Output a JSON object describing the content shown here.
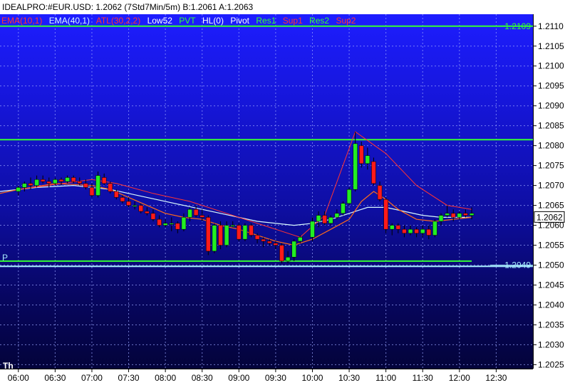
{
  "window": {
    "title": "IDEALPRO:#EUR.USD: 1.2062 (7Std7Min/5m)  B:1.2061 A:1.2063"
  },
  "legend": [
    {
      "label": "EMA(10,1)",
      "color": "#ff3333"
    },
    {
      "label": "EMA(40,1)",
      "color": "#d8f8ff"
    },
    {
      "label": "ATL(30,2,2)",
      "color": "#ff3333"
    },
    {
      "label": "Low52",
      "color": "#ffffff"
    },
    {
      "label": "PVT",
      "color": "#33ff33"
    },
    {
      "label": "HL(0)",
      "color": "#ffffff"
    },
    {
      "label": "Pivot",
      "color": "#ffffff"
    },
    {
      "label": "Res1",
      "color": "#33ff33"
    },
    {
      "label": "Sup1",
      "color": "#ff3333"
    },
    {
      "label": "Res2",
      "color": "#33ff33"
    },
    {
      "label": "Sup2",
      "color": "#ff3333"
    }
  ],
  "colors": {
    "up_candle": "#22ee22",
    "down_candle": "#ff1a1a",
    "wick": "#000000",
    "grid": "#9aa6ff",
    "green_line": "#33ff33",
    "cyan_line": "#a8ecff",
    "ema_short": "#ff6a1a",
    "ema_long": "#d8f8ff",
    "atl": "#ff3333"
  },
  "bottom": {
    "day_label": "Th"
  },
  "chart_data": {
    "type": "candlestick",
    "instrument": "IDEALPRO:#EUR.USD",
    "y_ticks": [
      "1.2110",
      "1.2105",
      "1.2100",
      "1.2095",
      "1.2090",
      "1.2085",
      "1.2080",
      "1.2075",
      "1.2070",
      "1.2065",
      "1.2060",
      "1.2055",
      "1.2050",
      "1.2045",
      "1.2040",
      "1.2035",
      "1.2030",
      "1.2025"
    ],
    "ylim": [
      1.2024,
      1.2113
    ],
    "x_ticks": [
      "06:00",
      "06:30",
      "07:00",
      "07:30",
      "08:00",
      "08:30",
      "09:00",
      "09:30",
      "10:00",
      "10:30",
      "11:00",
      "11:30",
      "12:00",
      "12:30"
    ],
    "x_range_minutes": [
      345,
      780
    ],
    "price_tags": [
      {
        "label": "1.2109",
        "value": 1.211,
        "color": "#33ff33"
      },
      {
        "label": "1.2049",
        "value": 1.205,
        "color": "#a8ecff"
      }
    ],
    "current_price": {
      "label": "1.2062",
      "value": 1.2062
    },
    "horizontal_lines": [
      {
        "name": "res-line-top",
        "value": 1.211,
        "color": "#33ff33",
        "to_min": 780
      },
      {
        "name": "res-line",
        "value": 1.20815,
        "color": "#33ff33",
        "to_min": 780
      },
      {
        "name": "pivot-line",
        "value": 1.2051,
        "color": "#33ff33",
        "to_min": 730,
        "label": "P"
      },
      {
        "name": "low-line",
        "value": 1.20497,
        "color": "#a8ecff",
        "to_min": 780
      }
    ],
    "candles": [
      {
        "t": 360,
        "o": 1.20685,
        "h": 1.207,
        "l": 1.20675,
        "c": 1.20695
      },
      {
        "t": 365,
        "o": 1.20695,
        "h": 1.2071,
        "l": 1.20685,
        "c": 1.20705
      },
      {
        "t": 370,
        "o": 1.20705,
        "h": 1.2072,
        "l": 1.2069,
        "c": 1.207
      },
      {
        "t": 375,
        "o": 1.207,
        "h": 1.20725,
        "l": 1.20695,
        "c": 1.20715
      },
      {
        "t": 380,
        "o": 1.20715,
        "h": 1.20725,
        "l": 1.20705,
        "c": 1.2071
      },
      {
        "t": 385,
        "o": 1.2071,
        "h": 1.2072,
        "l": 1.20695,
        "c": 1.20705
      },
      {
        "t": 390,
        "o": 1.20705,
        "h": 1.2072,
        "l": 1.207,
        "c": 1.20715
      },
      {
        "t": 395,
        "o": 1.20715,
        "h": 1.2072,
        "l": 1.207,
        "c": 1.2071
      },
      {
        "t": 400,
        "o": 1.2071,
        "h": 1.20725,
        "l": 1.20705,
        "c": 1.2072
      },
      {
        "t": 405,
        "o": 1.2072,
        "h": 1.20725,
        "l": 1.20705,
        "c": 1.2071
      },
      {
        "t": 410,
        "o": 1.2071,
        "h": 1.2072,
        "l": 1.207,
        "c": 1.20705
      },
      {
        "t": 415,
        "o": 1.20705,
        "h": 1.20715,
        "l": 1.2069,
        "c": 1.20695
      },
      {
        "t": 420,
        "o": 1.20695,
        "h": 1.20705,
        "l": 1.2067,
        "c": 1.20675
      },
      {
        "t": 425,
        "o": 1.20675,
        "h": 1.20735,
        "l": 1.2067,
        "c": 1.20725
      },
      {
        "t": 430,
        "o": 1.2072,
        "h": 1.2073,
        "l": 1.207,
        "c": 1.20705
      },
      {
        "t": 435,
        "o": 1.20705,
        "h": 1.2071,
        "l": 1.2068,
        "c": 1.20685
      },
      {
        "t": 440,
        "o": 1.20685,
        "h": 1.2069,
        "l": 1.20665,
        "c": 1.2067
      },
      {
        "t": 445,
        "o": 1.2067,
        "h": 1.20675,
        "l": 1.20655,
        "c": 1.2066
      },
      {
        "t": 450,
        "o": 1.2066,
        "h": 1.2067,
        "l": 1.20645,
        "c": 1.2065
      },
      {
        "t": 455,
        "o": 1.2065,
        "h": 1.2066,
        "l": 1.2064,
        "c": 1.2065
      },
      {
        "t": 460,
        "o": 1.2065,
        "h": 1.20655,
        "l": 1.2063,
        "c": 1.20635
      },
      {
        "t": 465,
        "o": 1.20635,
        "h": 1.20645,
        "l": 1.20625,
        "c": 1.2063
      },
      {
        "t": 470,
        "o": 1.2063,
        "h": 1.2064,
        "l": 1.2061,
        "c": 1.20615
      },
      {
        "t": 475,
        "o": 1.20615,
        "h": 1.20625,
        "l": 1.20595,
        "c": 1.206
      },
      {
        "t": 480,
        "o": 1.206,
        "h": 1.20615,
        "l": 1.20595,
        "c": 1.20605
      },
      {
        "t": 485,
        "o": 1.20605,
        "h": 1.2062,
        "l": 1.20585,
        "c": 1.20605
      },
      {
        "t": 490,
        "o": 1.20605,
        "h": 1.2061,
        "l": 1.2058,
        "c": 1.2059
      },
      {
        "t": 495,
        "o": 1.2059,
        "h": 1.2063,
        "l": 1.20585,
        "c": 1.2062
      },
      {
        "t": 500,
        "o": 1.2062,
        "h": 1.20645,
        "l": 1.2061,
        "c": 1.2064
      },
      {
        "t": 505,
        "o": 1.2064,
        "h": 1.2065,
        "l": 1.2062,
        "c": 1.20625
      },
      {
        "t": 510,
        "o": 1.20625,
        "h": 1.2064,
        "l": 1.2061,
        "c": 1.2062
      },
      {
        "t": 515,
        "o": 1.2062,
        "h": 1.20625,
        "l": 1.20525,
        "c": 1.20535
      },
      {
        "t": 520,
        "o": 1.20535,
        "h": 1.20605,
        "l": 1.2053,
        "c": 1.206
      },
      {
        "t": 525,
        "o": 1.206,
        "h": 1.2061,
        "l": 1.2054,
        "c": 1.2055
      },
      {
        "t": 530,
        "o": 1.2055,
        "h": 1.2061,
        "l": 1.20545,
        "c": 1.206
      },
      {
        "t": 535,
        "o": 1.206,
        "h": 1.2061,
        "l": 1.20595,
        "c": 1.206
      },
      {
        "t": 540,
        "o": 1.206,
        "h": 1.20605,
        "l": 1.2056,
        "c": 1.20565
      },
      {
        "t": 545,
        "o": 1.20565,
        "h": 1.20605,
        "l": 1.2056,
        "c": 1.206
      },
      {
        "t": 550,
        "o": 1.206,
        "h": 1.20605,
        "l": 1.2057,
        "c": 1.20575
      },
      {
        "t": 555,
        "o": 1.20575,
        "h": 1.2058,
        "l": 1.20555,
        "c": 1.20565
      },
      {
        "t": 560,
        "o": 1.20565,
        "h": 1.2057,
        "l": 1.20545,
        "c": 1.2056
      },
      {
        "t": 565,
        "o": 1.2056,
        "h": 1.20565,
        "l": 1.2055,
        "c": 1.20555
      },
      {
        "t": 570,
        "o": 1.20555,
        "h": 1.2056,
        "l": 1.2054,
        "c": 1.2055
      },
      {
        "t": 575,
        "o": 1.2055,
        "h": 1.20555,
        "l": 1.20505,
        "c": 1.2051
      },
      {
        "t": 580,
        "o": 1.2051,
        "h": 1.20535,
        "l": 1.20505,
        "c": 1.2052
      },
      {
        "t": 585,
        "o": 1.2052,
        "h": 1.20565,
        "l": 1.2051,
        "c": 1.2056
      },
      {
        "t": 590,
        "o": 1.2056,
        "h": 1.20575,
        "l": 1.20555,
        "c": 1.2057
      },
      {
        "t": 600,
        "o": 1.2057,
        "h": 1.2062,
        "l": 1.2056,
        "c": 1.2061
      },
      {
        "t": 605,
        "o": 1.2061,
        "h": 1.20635,
        "l": 1.20595,
        "c": 1.20625
      },
      {
        "t": 610,
        "o": 1.20625,
        "h": 1.20635,
        "l": 1.206,
        "c": 1.20605
      },
      {
        "t": 615,
        "o": 1.20605,
        "h": 1.20625,
        "l": 1.206,
        "c": 1.2062
      },
      {
        "t": 620,
        "o": 1.2062,
        "h": 1.2064,
        "l": 1.20615,
        "c": 1.2063
      },
      {
        "t": 625,
        "o": 1.2063,
        "h": 1.2066,
        "l": 1.20625,
        "c": 1.20655
      },
      {
        "t": 630,
        "o": 1.20655,
        "h": 1.20695,
        "l": 1.2065,
        "c": 1.2069
      },
      {
        "t": 635,
        "o": 1.2069,
        "h": 1.20835,
        "l": 1.20685,
        "c": 1.20805
      },
      {
        "t": 640,
        "o": 1.208,
        "h": 1.2081,
        "l": 1.20745,
        "c": 1.20755
      },
      {
        "t": 645,
        "o": 1.20755,
        "h": 1.20795,
        "l": 1.2074,
        "c": 1.20775
      },
      {
        "t": 650,
        "o": 1.2076,
        "h": 1.2077,
        "l": 1.207,
        "c": 1.20705
      },
      {
        "t": 655,
        "o": 1.207,
        "h": 1.2071,
        "l": 1.2066,
        "c": 1.20665
      },
      {
        "t": 660,
        "o": 1.20665,
        "h": 1.2067,
        "l": 1.2058,
        "c": 1.2059
      },
      {
        "t": 665,
        "o": 1.2059,
        "h": 1.20605,
        "l": 1.20575,
        "c": 1.206
      },
      {
        "t": 670,
        "o": 1.206,
        "h": 1.20605,
        "l": 1.2058,
        "c": 1.2059
      },
      {
        "t": 675,
        "o": 1.2059,
        "h": 1.206,
        "l": 1.2057,
        "c": 1.2058
      },
      {
        "t": 680,
        "o": 1.2058,
        "h": 1.206,
        "l": 1.20575,
        "c": 1.2059
      },
      {
        "t": 685,
        "o": 1.2059,
        "h": 1.20595,
        "l": 1.2057,
        "c": 1.2058
      },
      {
        "t": 690,
        "o": 1.2058,
        "h": 1.206,
        "l": 1.2057,
        "c": 1.2059
      },
      {
        "t": 695,
        "o": 1.2059,
        "h": 1.206,
        "l": 1.20565,
        "c": 1.20575
      },
      {
        "t": 700,
        "o": 1.20575,
        "h": 1.20615,
        "l": 1.2057,
        "c": 1.2061
      },
      {
        "t": 705,
        "o": 1.2061,
        "h": 1.2063,
        "l": 1.206,
        "c": 1.20625
      },
      {
        "t": 710,
        "o": 1.20625,
        "h": 1.2065,
        "l": 1.2062,
        "c": 1.2063
      },
      {
        "t": 715,
        "o": 1.2063,
        "h": 1.2064,
        "l": 1.2061,
        "c": 1.2062
      },
      {
        "t": 720,
        "o": 1.2062,
        "h": 1.20635,
        "l": 1.20615,
        "c": 1.2063
      },
      {
        "t": 725,
        "o": 1.2063,
        "h": 1.2064,
        "l": 1.2062,
        "c": 1.20625
      },
      {
        "t": 730,
        "o": 1.20625,
        "h": 1.20645,
        "l": 1.20615,
        "c": 1.2063
      }
    ],
    "ema_short": [
      [
        345,
        1.2068
      ],
      [
        360,
        1.2069
      ],
      [
        390,
        1.20705
      ],
      [
        420,
        1.207
      ],
      [
        435,
        1.2069
      ],
      [
        450,
        1.2067
      ],
      [
        465,
        1.2065
      ],
      [
        480,
        1.2063
      ],
      [
        495,
        1.2062
      ],
      [
        510,
        1.20615
      ],
      [
        525,
        1.206
      ],
      [
        540,
        1.2059
      ],
      [
        555,
        1.20575
      ],
      [
        570,
        1.2056
      ],
      [
        585,
        1.2055
      ],
      [
        600,
        1.20565
      ],
      [
        615,
        1.2059
      ],
      [
        630,
        1.20615
      ],
      [
        640,
        1.2066
      ],
      [
        650,
        1.20685
      ],
      [
        660,
        1.20665
      ],
      [
        670,
        1.2064
      ],
      [
        685,
        1.20615
      ],
      [
        700,
        1.2061
      ],
      [
        715,
        1.20615
      ],
      [
        730,
        1.2062
      ]
    ],
    "ema_long": [
      [
        345,
        1.20685
      ],
      [
        375,
        1.20695
      ],
      [
        405,
        1.207
      ],
      [
        435,
        1.2069
      ],
      [
        465,
        1.2067
      ],
      [
        495,
        1.2065
      ],
      [
        525,
        1.2063
      ],
      [
        555,
        1.2061
      ],
      [
        585,
        1.206
      ],
      [
        600,
        1.20605
      ],
      [
        615,
        1.20615
      ],
      [
        630,
        1.2063
      ],
      [
        645,
        1.20645
      ],
      [
        660,
        1.20645
      ],
      [
        675,
        1.20635
      ],
      [
        690,
        1.20625
      ],
      [
        705,
        1.2062
      ],
      [
        730,
        1.2062
      ]
    ],
    "atl": [
      [
        360,
        1.2069
      ],
      [
        420,
        1.20715
      ],
      [
        440,
        1.20705
      ],
      [
        470,
        1.2068
      ],
      [
        500,
        1.2066
      ],
      [
        530,
        1.2063
      ],
      [
        560,
        1.206
      ],
      [
        590,
        1.2057
      ],
      [
        610,
        1.20625
      ],
      [
        635,
        1.20835
      ],
      [
        660,
        1.2078
      ],
      [
        685,
        1.207
      ],
      [
        710,
        1.2065
      ],
      [
        730,
        1.2064
      ]
    ]
  }
}
